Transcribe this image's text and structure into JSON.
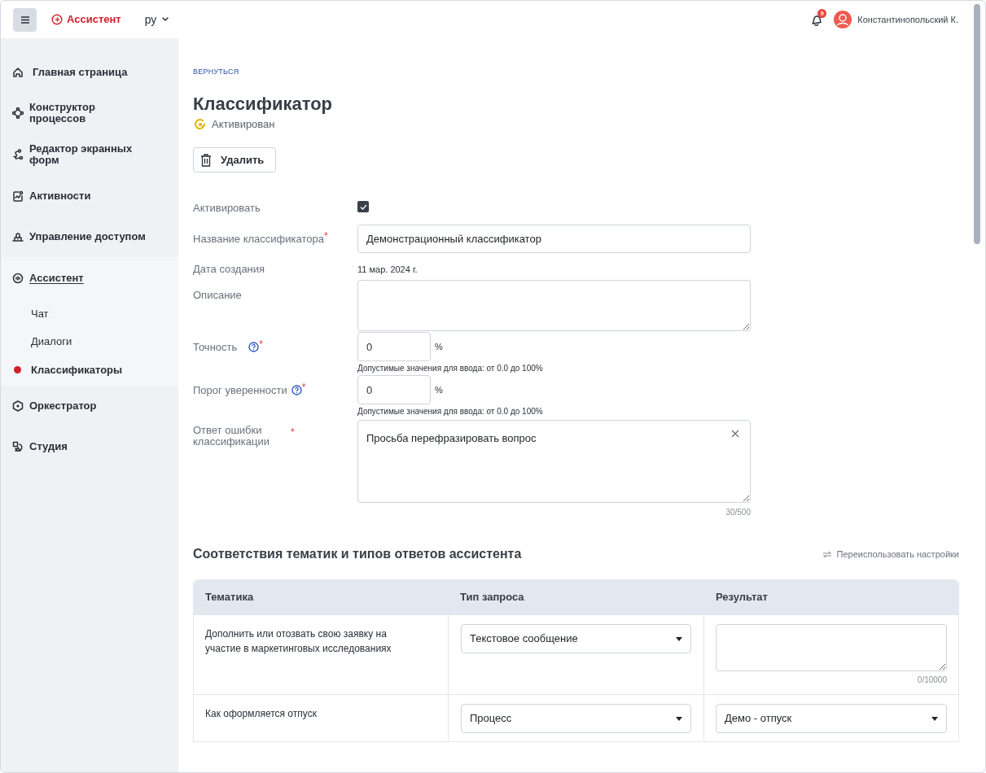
{
  "header": {
    "logo": "Ассистент",
    "language": "ру",
    "notifications": "9",
    "user": "Константинопольский К."
  },
  "sidebar": {
    "items": [
      {
        "label": "Главная страница",
        "selected": false,
        "expanded": false
      },
      {
        "label": "Конструктор процессов",
        "selected": false,
        "expanded": false
      },
      {
        "label": "Редактор экранных форм",
        "selected": false,
        "expanded": false
      },
      {
        "label": "Активности",
        "selected": false,
        "expanded": false
      },
      {
        "label": "Управление доступом",
        "selected": false,
        "expanded": false
      },
      {
        "label": "Ассистент",
        "selected": false,
        "expanded": true,
        "children": [
          {
            "label": "Чат",
            "selected": false
          },
          {
            "label": "Диалоги",
            "selected": false
          },
          {
            "label": "Классификаторы",
            "selected": true
          }
        ]
      },
      {
        "label": "Оркестратор",
        "selected": false,
        "expanded": false
      },
      {
        "label": "Студия",
        "selected": false,
        "expanded": false
      }
    ]
  },
  "back_link": "ВЕРНУТЬСЯ",
  "title": "Классификатор",
  "status": "Активирован",
  "delete_button": "Удалить",
  "form": {
    "fields": [
      {
        "kind": "checkbox",
        "label": "Активировать",
        "checked": true
      },
      {
        "kind": "input",
        "label": "Название классификатора",
        "required_mark": "*",
        "value": "Демонстрационный классификатор"
      },
      {
        "kind": "text",
        "label": "Дата создания",
        "value": "11 мар. 2024 г."
      },
      {
        "kind": "textarea",
        "label": "Описание"
      },
      {
        "kind": "percent",
        "label": "Точность",
        "required_mark": "*",
        "help": true,
        "value": "0",
        "unit": "%",
        "hint": "Допустимые значения для ввода: от 0.0 до 100%"
      },
      {
        "kind": "percent",
        "label": "Порог уверенности",
        "required_mark": "*",
        "help": true,
        "value": "0",
        "unit": "%",
        "hint": "Допустимые значения для ввода: от 0.0 до 100%"
      },
      {
        "kind": "textarea",
        "label": "Ответ ошибки классификации",
        "required_mark": "*",
        "value": "Просьба перефразировать вопрос",
        "clearable": true,
        "counter": "30/500"
      }
    ]
  },
  "section": {
    "title": "Соответствия тематик и типов ответов ассистента",
    "reuse_link": "Переиспользовать настройки"
  },
  "table": {
    "columns": [
      "Тематика",
      "Тип запроса",
      "Результат"
    ],
    "rows": [
      {
        "topic": "Дополнить или отозвать свою заявку на участие в маркетинговых исследованиях",
        "request_type": "Текстовое сообщение",
        "result": {
          "kind": "textarea",
          "counter": "0/10000"
        }
      },
      {
        "topic": "Как оформляется отпуск",
        "request_type": "Процесс",
        "result": {
          "kind": "select",
          "value": "Демо - отпуск"
        }
      }
    ]
  }
}
